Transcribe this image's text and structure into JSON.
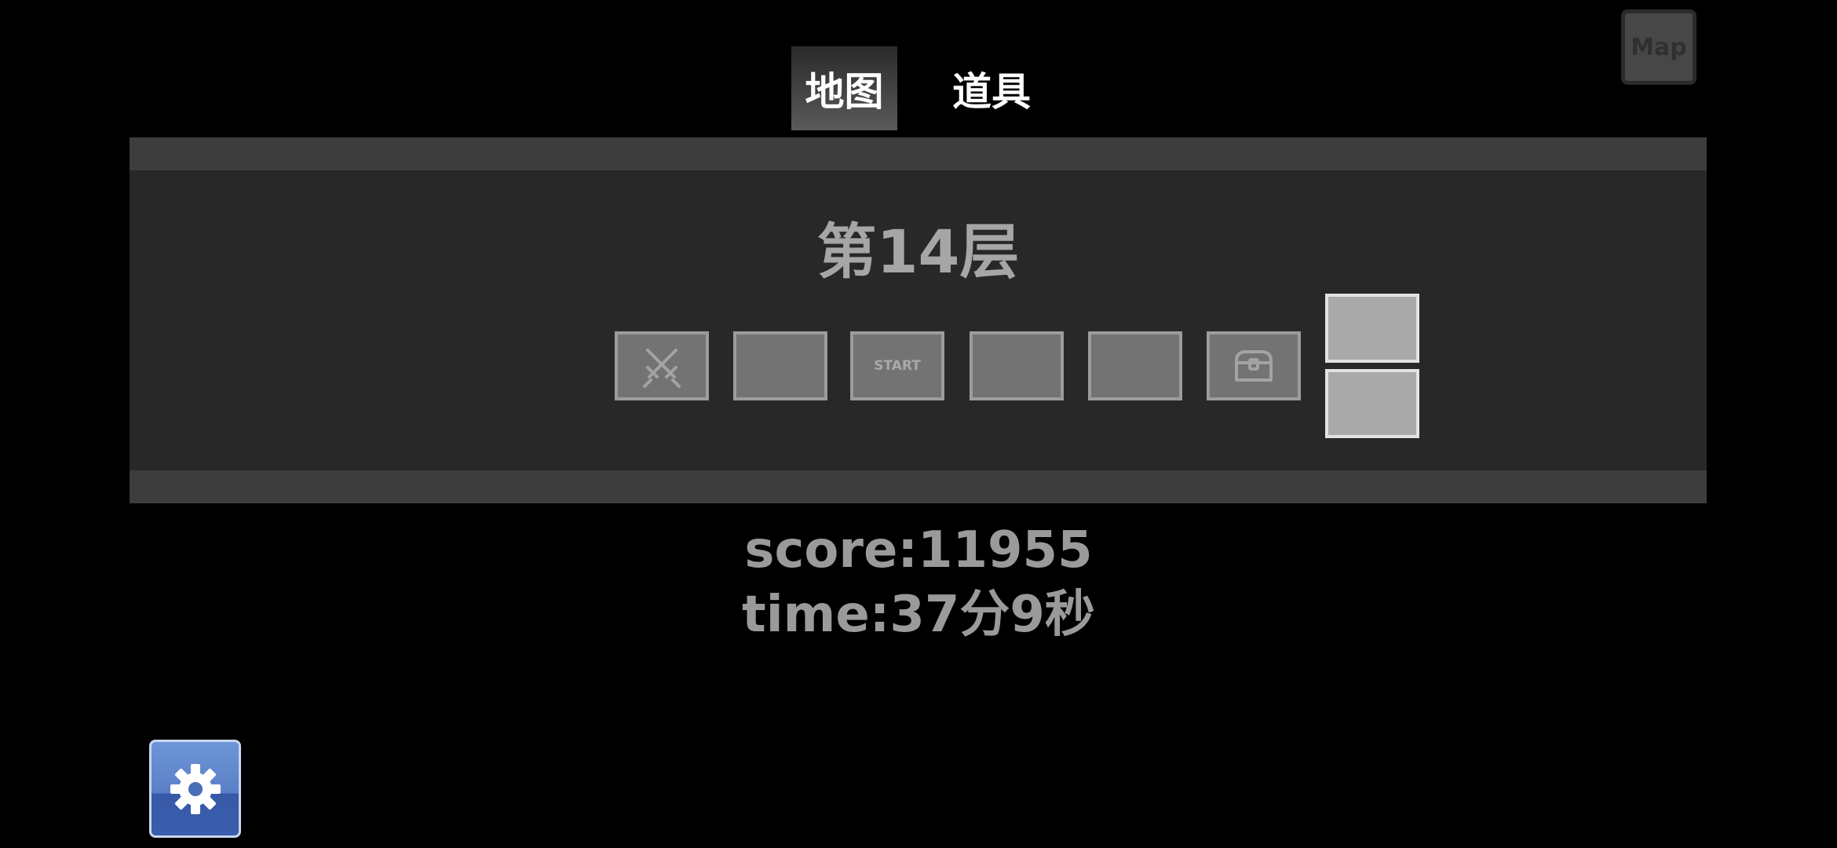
{
  "tabs": [
    {
      "label": "地图",
      "active": true
    },
    {
      "label": "道具",
      "active": false
    }
  ],
  "map_button": {
    "label": "Map"
  },
  "floor": {
    "title": "第14层"
  },
  "rooms": [
    {
      "icon": "crossed-swords-icon"
    },
    {},
    {
      "label": "START"
    },
    {},
    {},
    {
      "icon": "treasure-chest-icon"
    },
    {},
    {}
  ],
  "stats": {
    "score": "score:11955",
    "time": "time:37分9秒"
  },
  "settings": {
    "icon": "gear-icon"
  },
  "colors": {
    "background": "#000000",
    "panel": "#282828",
    "panel_bar": "#3d3d3d",
    "room": "#737373",
    "room_light": "#a9a9a9",
    "text_gray": "#9a9a9a",
    "settings_blue": "#5a7fc6"
  }
}
